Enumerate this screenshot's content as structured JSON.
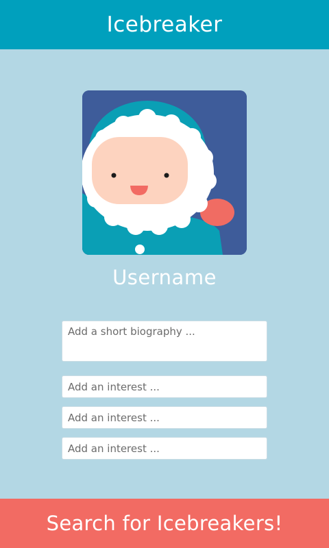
{
  "header": {
    "title": "Icebreaker"
  },
  "profile": {
    "avatar_icon": "eskimo-avatar-icon",
    "username": "Username"
  },
  "form": {
    "bio_placeholder": "Add a short biography ...",
    "interests": [
      {
        "placeholder": "Add an interest ..."
      },
      {
        "placeholder": "Add an interest ..."
      },
      {
        "placeholder": "Add an interest ..."
      }
    ]
  },
  "footer": {
    "search_label": "Search for Icebreakers!"
  },
  "colors": {
    "header": "#00a0bd",
    "background": "#b3d7e4",
    "button": "#f26b63",
    "avatar_bg": "#3e5c9a"
  }
}
